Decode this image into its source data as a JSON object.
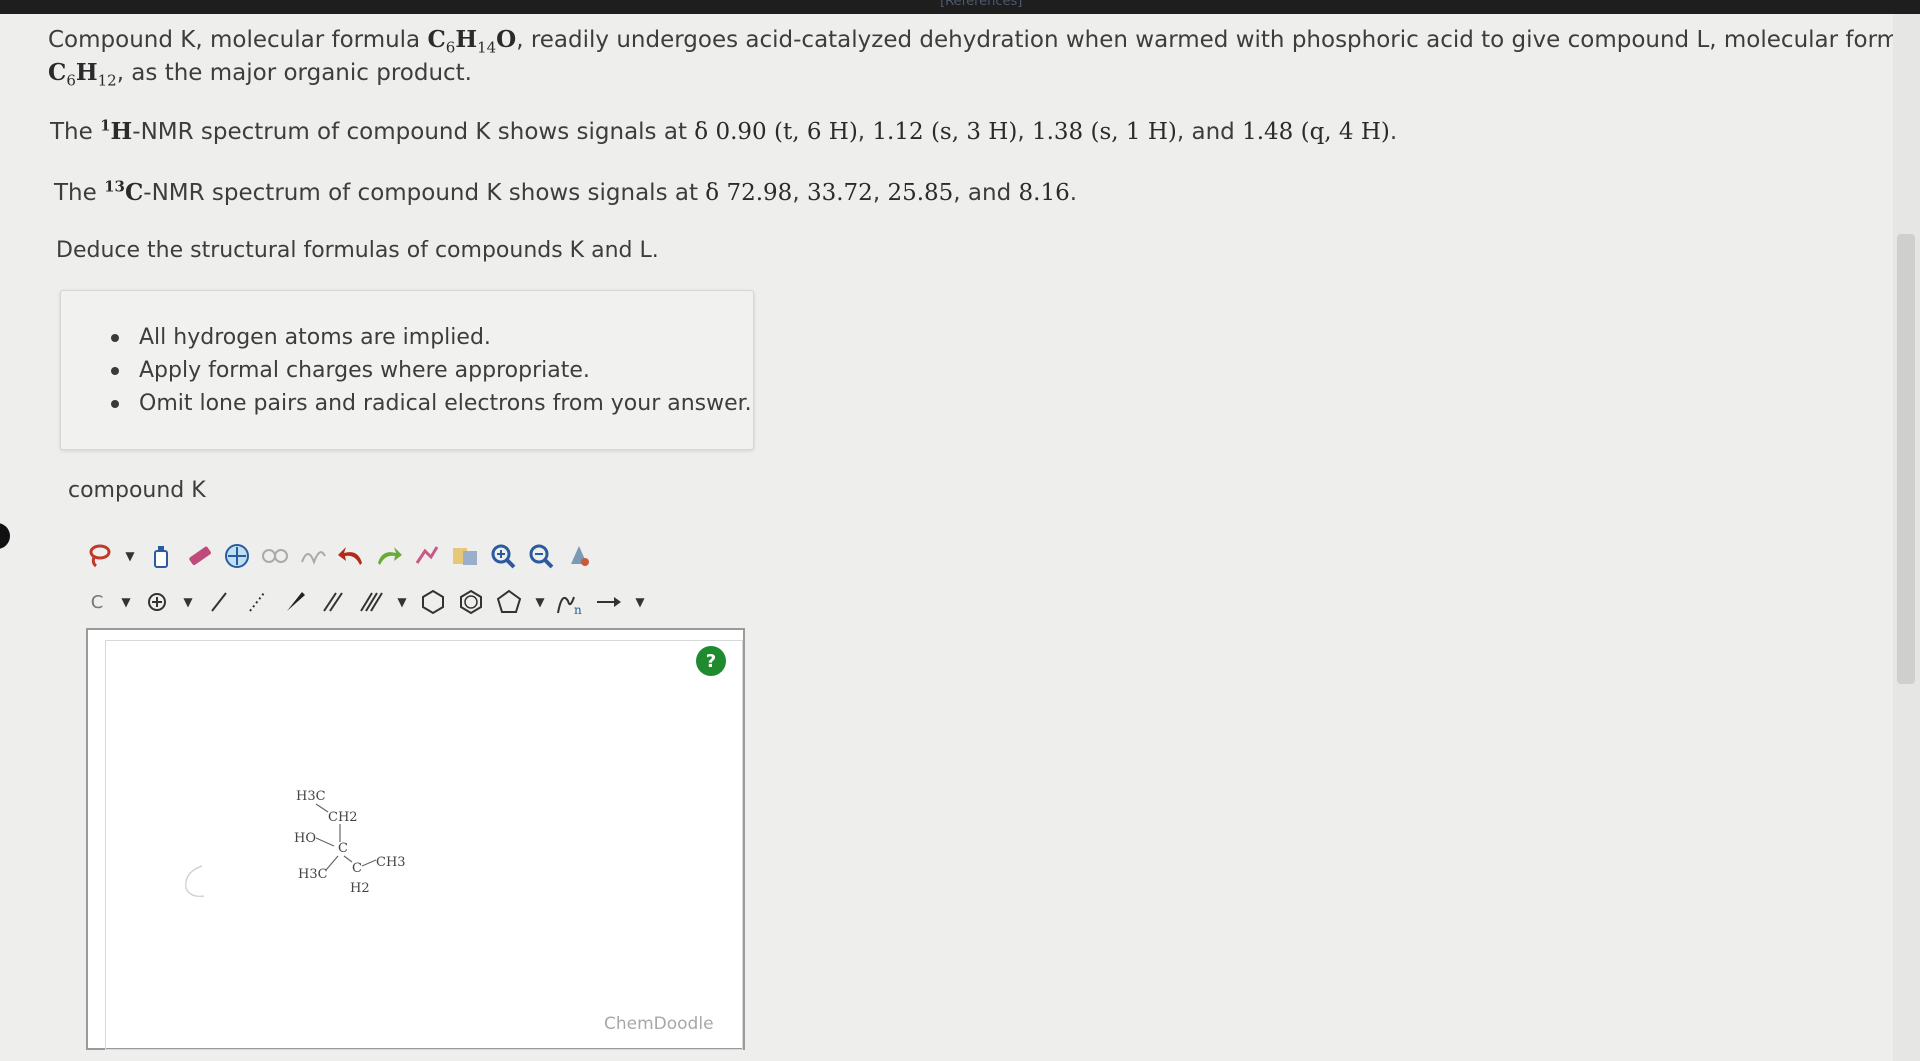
{
  "header": {
    "ref_label": "[References]"
  },
  "question": {
    "line1_a": "Compound K, molecular formula ",
    "f1_c": "C",
    "f1_c_sub": "6",
    "f1_h": "H",
    "f1_h_sub": "14",
    "f1_o": "O",
    "line1_b": ", readily undergoes acid-catalyzed dehydration when warmed with phosphoric acid to give compound L, molecular formula",
    "f2_c": "C",
    "f2_c_sub": "6",
    "f2_h": "H",
    "f2_h_sub": "12",
    "line2_b": ", as the major organic product.",
    "hnmr_a": "The ",
    "hnmr_sup": "1",
    "hnmr_h": "H",
    "hnmr_b": "-NMR spectrum of compound K shows signals at ",
    "hnmr_delta": "δ",
    "hnmr_s1": "0.90 (t, 6 H)",
    "hnmr_s2": "1.12 (s, 3 H)",
    "hnmr_s3": "1.38 (s, 1 H)",
    "hnmr_and": ", and ",
    "hnmr_s4": "1.48 (q, 4 H)",
    "hnmr_end": ".",
    "cnmr_a": "The ",
    "cnmr_sup": "13",
    "cnmr_c": "C",
    "cnmr_b": "-NMR spectrum of compound K shows signals at ",
    "cnmr_delta": "δ",
    "cnmr_s1": "72.98",
    "cnmr_s2": "33.72",
    "cnmr_s3": "25.85",
    "cnmr_and": ", and ",
    "cnmr_s4": "8.16",
    "cnmr_end": ".",
    "deduce": "Deduce the structural formulas of compounds K and L."
  },
  "hints": [
    "All hydrogen atoms are implied.",
    "Apply formal charges where appropriate.",
    "Omit lone pairs and radical electrons from your answer."
  ],
  "editor": {
    "label": "compound K",
    "element_select": "C",
    "help": "?",
    "brand": "ChemDoodle",
    "mol_labels": {
      "h3c_top": "H3C",
      "ch2": "CH2",
      "ho": "HO",
      "c": "C",
      "h3c_bottom": "H3C",
      "c2": "C",
      "ch3": "CH3",
      "h2": "H2"
    }
  },
  "colors": {
    "help_green": "#1f8a2e",
    "lasso_red": "#c0392b",
    "zoom_blue": "#2a5aa0"
  }
}
